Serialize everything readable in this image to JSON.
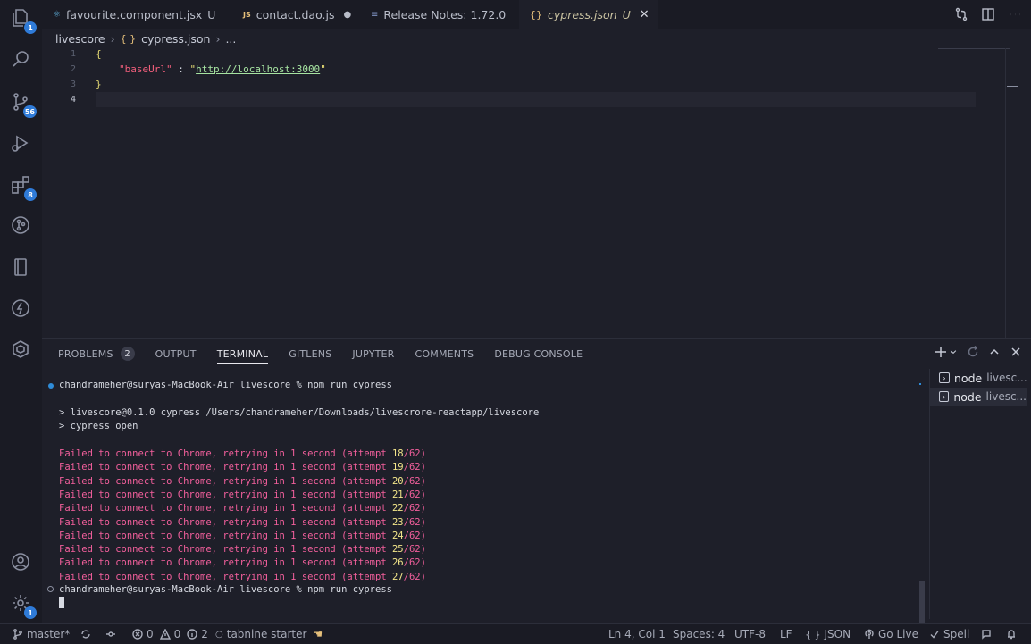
{
  "activity": {
    "explorer_badge": "1",
    "scm_badge": "56",
    "extensions_badge": "8",
    "settings_badge": "1"
  },
  "tabs": [
    {
      "icon": "⚛",
      "title": "favourite.component.jsx",
      "suffix": "U"
    },
    {
      "icon": "JS",
      "title": "contact.dao.js",
      "suffix": "●"
    },
    {
      "icon": "≡",
      "title": "Release Notes: 1.72.0",
      "suffix": ""
    },
    {
      "icon": "{}",
      "title": "cypress.json",
      "suffix": "U"
    }
  ],
  "breadcrumb": {
    "folder": "livescore",
    "file": "cypress.json",
    "more": "..."
  },
  "editor": {
    "line_numbers": [
      "1",
      "2",
      "3",
      "4"
    ],
    "open_brace": "{",
    "key": "\"baseUrl\"",
    "colon": " : ",
    "value_quote_open": "\"",
    "value": "http://localhost:3000",
    "value_quote_close": "\"",
    "close_brace": "}"
  },
  "panel": {
    "tabs": [
      "PROBLEMS",
      "OUTPUT",
      "TERMINAL",
      "GITLENS",
      "JUPYTER",
      "COMMENTS",
      "DEBUG CONSOLE"
    ],
    "problems_count": "2",
    "active_tab": "TERMINAL"
  },
  "terminal": {
    "prompt1": "chandrameher@suryas-MacBook-Air livescore % npm run cypress",
    "script1": "> livescore@0.1.0 cypress /Users/chandrameher/Downloads/livescrore-reactapp/livescore",
    "script2": "> cypress open",
    "fail_prefix": "Failed to connect to Chrome, retrying in 1 second (attempt ",
    "fail_total": "/62)",
    "attempts": [
      "18",
      "19",
      "20",
      "21",
      "22",
      "23",
      "24",
      "25",
      "26",
      "27"
    ],
    "prompt2": "chandrameher@suryas-MacBook-Air livescore % npm run cypress"
  },
  "terminal_list": [
    {
      "name": "node",
      "sub": "livesc..."
    },
    {
      "name": "node",
      "sub": "livesc..."
    }
  ],
  "status": {
    "branch": "master*",
    "errors": "0",
    "warnings": "0",
    "info": "2",
    "tabnine": "tabnine starter",
    "position": "Ln 4, Col 1",
    "spaces": "Spaces: 4",
    "encoding": "UTF-8",
    "eol": "LF",
    "language": "JSON",
    "golive": "Go Live",
    "spell": "Spell"
  }
}
